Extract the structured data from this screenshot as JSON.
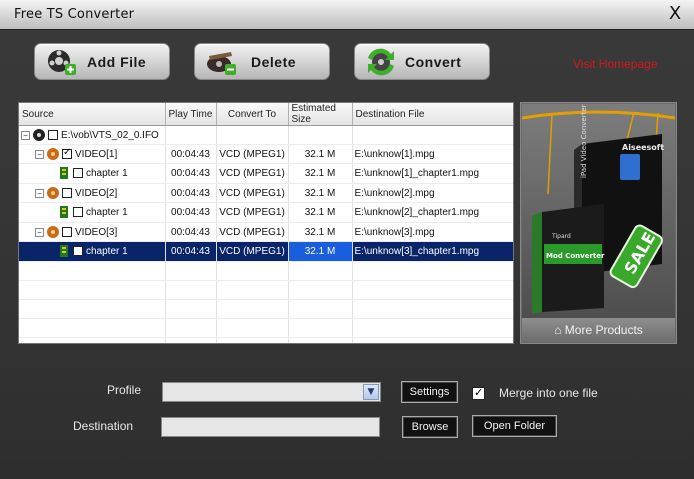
{
  "window": {
    "title": "Free TS Converter",
    "close": "X"
  },
  "toolbar": {
    "add_file": "Add  File",
    "delete": "Delete",
    "convert": "Convert",
    "visit": "Visit Homepage"
  },
  "table": {
    "columns": [
      "Source",
      "Play Time",
      "Convert To",
      "Estimated Size",
      "Destination File"
    ],
    "rows": [
      {
        "source": "E:\\vob\\VTS_02_0.IFO",
        "time": "",
        "format": "",
        "size": "",
        "dest": ""
      },
      {
        "source": "VIDEO[1]",
        "time": "00:04:43",
        "format": "VCD (MPEG1)",
        "size": "32.1 M",
        "dest": "E:\\unknow[1].mpg"
      },
      {
        "source": "chapter 1",
        "time": "00:04:43",
        "format": "VCD (MPEG1)",
        "size": "32.1 M",
        "dest": "E:\\unknow[1]_chapter1.mpg"
      },
      {
        "source": "VIDEO[2]",
        "time": "00:04:43",
        "format": "VCD (MPEG1)",
        "size": "32.1 M",
        "dest": "E:\\unknow[2].mpg"
      },
      {
        "source": "chapter 1",
        "time": "00:04:43",
        "format": "VCD (MPEG1)",
        "size": "32.1 M",
        "dest": "E:\\unknow[2]_chapter1.mpg"
      },
      {
        "source": "VIDEO[3]",
        "time": "00:04:43",
        "format": "VCD (MPEG1)",
        "size": "32.1 M",
        "dest": "E:\\unknow[3].mpg"
      },
      {
        "source": "chapter 1",
        "time": "00:04:43",
        "format": "VCD (MPEG1)",
        "size": "32.1 M",
        "dest": "E:\\unknow[3]_chapter1.mpg"
      }
    ]
  },
  "side": {
    "more_products": "More Products",
    "brand": "Aiseesoft",
    "product1": "iPad Video Converter",
    "product2_brand": "Tipard",
    "product2": "Mod Converter",
    "sale": "SALE"
  },
  "bottom": {
    "profile_label": "Profile",
    "destination_label": "Destination",
    "settings": "Settings",
    "merge": "Merge into one file",
    "browse": "Browse",
    "open_folder": "Open Folder"
  }
}
